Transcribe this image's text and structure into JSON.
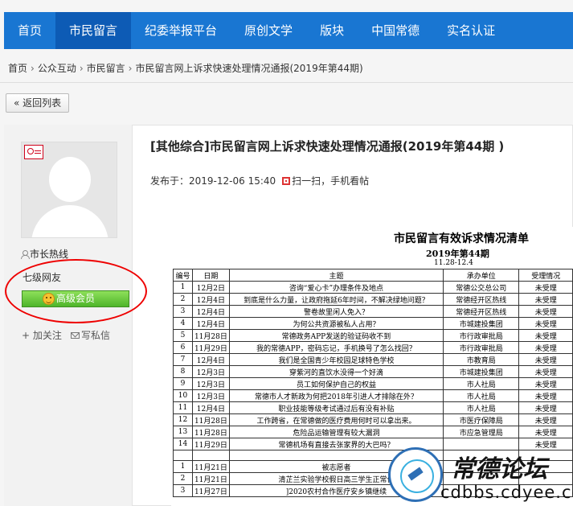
{
  "nav": {
    "items": [
      {
        "label": "首页",
        "active": false
      },
      {
        "label": "市民留言",
        "active": true
      },
      {
        "label": "纪委举报平台",
        "active": false
      },
      {
        "label": "原创文学",
        "active": false
      },
      {
        "label": "版块",
        "active": false
      },
      {
        "label": "中国常德",
        "active": false
      },
      {
        "label": "实名认证",
        "active": false
      }
    ]
  },
  "breadcrumb": [
    "首页",
    "公众互动",
    "市民留言",
    "市民留言网上诉求快速处理情况通报(2019年第44期)"
  ],
  "back_button": "« 返回列表",
  "user": {
    "name": "市长热线",
    "level": "七级网友",
    "badge": "高级会员",
    "follow": "+ 加关注",
    "message": "写私信"
  },
  "post": {
    "title": "[其他综合]市民留言网上诉求快速处理情况通报(2019年第44期 )",
    "posted_at_label": "发布于：",
    "posted_at": "2019-12-06 15:40",
    "scan_text": "扫一扫，手机看帖"
  },
  "report": {
    "title": "市民留言有效诉求情况清单",
    "subtitle": "2019年第44期",
    "range": "11.28-12.4",
    "headers": [
      "编号",
      "日期",
      "主题",
      "承办单位",
      "受理情况"
    ],
    "rows": [
      [
        "1",
        "12月2日",
        "咨询“爱心卡”办理条件及地点",
        "常德公交总公司",
        "未受理"
      ],
      [
        "2",
        "12月4日",
        "到底是什么力量，让政府拖延6年时间，不解决绿地问题？",
        "常德经开区热线",
        "未受理"
      ],
      [
        "3",
        "12月4日",
        "警卷故里闲人免入？",
        "常德经开区热线",
        "未受理"
      ],
      [
        "4",
        "12月4日",
        "为何公共资源被私人占用？",
        "市城建投集团",
        "未受理"
      ],
      [
        "5",
        "11月28日",
        "常德政务APP发送的验证码收不到",
        "市行政审批局",
        "未受理"
      ],
      [
        "6",
        "11月29日",
        "我的常德APP，密码忘记，手机换号了怎么找回？",
        "市行政审批局",
        "未受理"
      ],
      [
        "7",
        "12月4日",
        "我们是全国青少年校园足球特色学校",
        "市教育局",
        "未受理"
      ],
      [
        "8",
        "12月3日",
        "穿紫河的直饮水没得一个好滴",
        "市城建投集团",
        "未受理"
      ],
      [
        "9",
        "12月3日",
        "员工如何保护自己的权益",
        "市人社局",
        "未受理"
      ],
      [
        "10",
        "12月3日",
        "常德市人才新政为何把2018年引进人才排除在外？",
        "市人社局",
        "未受理"
      ],
      [
        "11",
        "12月4日",
        "职业技能等级考试通过后有没有补贴",
        "市人社局",
        "未受理"
      ],
      [
        "12",
        "11月28日",
        "工作跨省，在常德做的医疗费用何时可以拿出来。",
        "市医疗保障局",
        "未受理"
      ],
      [
        "13",
        "11月28日",
        "危险品运输管理有较大漏洞",
        "市应急管理局",
        "未受理"
      ],
      [
        "14",
        "11月29日",
        "常德机场有直接去张家界的大巴吗？",
        "",
        "未受理"
      ]
    ],
    "rows2": [
      [
        "1",
        "11月21日",
        "被志愿者",
        "",
        ""
      ],
      [
        "2",
        "11月21日",
        "清芷兰实验学校假日高三学生正常作",
        "",
        ""
      ],
      [
        "3",
        "11月27日",
        "]2020农村合作医疗安乡镇继续",
        "",
        ""
      ]
    ]
  },
  "watermark": {
    "title": "常德论坛",
    "url": "cdbbs.cdyee.com"
  }
}
